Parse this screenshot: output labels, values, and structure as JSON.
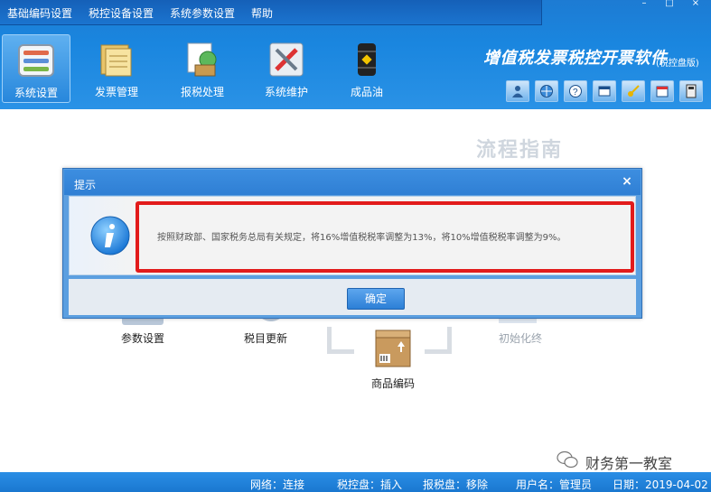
{
  "menu": [
    "基础编码设置",
    "税控设备设置",
    "系统参数设置",
    "帮助"
  ],
  "toolbar": [
    {
      "label": "系统设置",
      "icon": "settings-panel-icon",
      "active": true
    },
    {
      "label": "发票管理",
      "icon": "invoice-folder-icon",
      "active": false
    },
    {
      "label": "报税处理",
      "icon": "tax-report-icon",
      "active": false
    },
    {
      "label": "系统维护",
      "icon": "maintenance-tools-icon",
      "active": false
    },
    {
      "label": "成品油",
      "icon": "oil-barrel-icon",
      "active": false
    }
  ],
  "app": {
    "title": "增值税发票税控开票软件",
    "subtitle": "(税控盘版)"
  },
  "utility_icons": [
    "user-icon",
    "globe-icon",
    "help-icon",
    "window-icon",
    "key-icon",
    "calendar-icon",
    "calculator-icon"
  ],
  "flow": {
    "title": "流程指南",
    "items": [
      "参数设置",
      "税目更新",
      "商品编码",
      "初始化终"
    ]
  },
  "dialog": {
    "title": "提示",
    "close": "×",
    "message": "按照财政部、国家税务总局有关规定，将16%增值税税率调整为13%，将10%增值税税率调整为9%。",
    "ok": "确定"
  },
  "status": {
    "network": "网络：连接",
    "tax_disk": "税控盘：插入",
    "report_disk": "报税盘：移除",
    "user": "用户名：管理员",
    "date": "日期：2019-04-02"
  },
  "watermark": "财务第一教室",
  "colors": {
    "header": "#1a86df",
    "highlight": "#e21b1b",
    "button": "#2c7fd6"
  }
}
